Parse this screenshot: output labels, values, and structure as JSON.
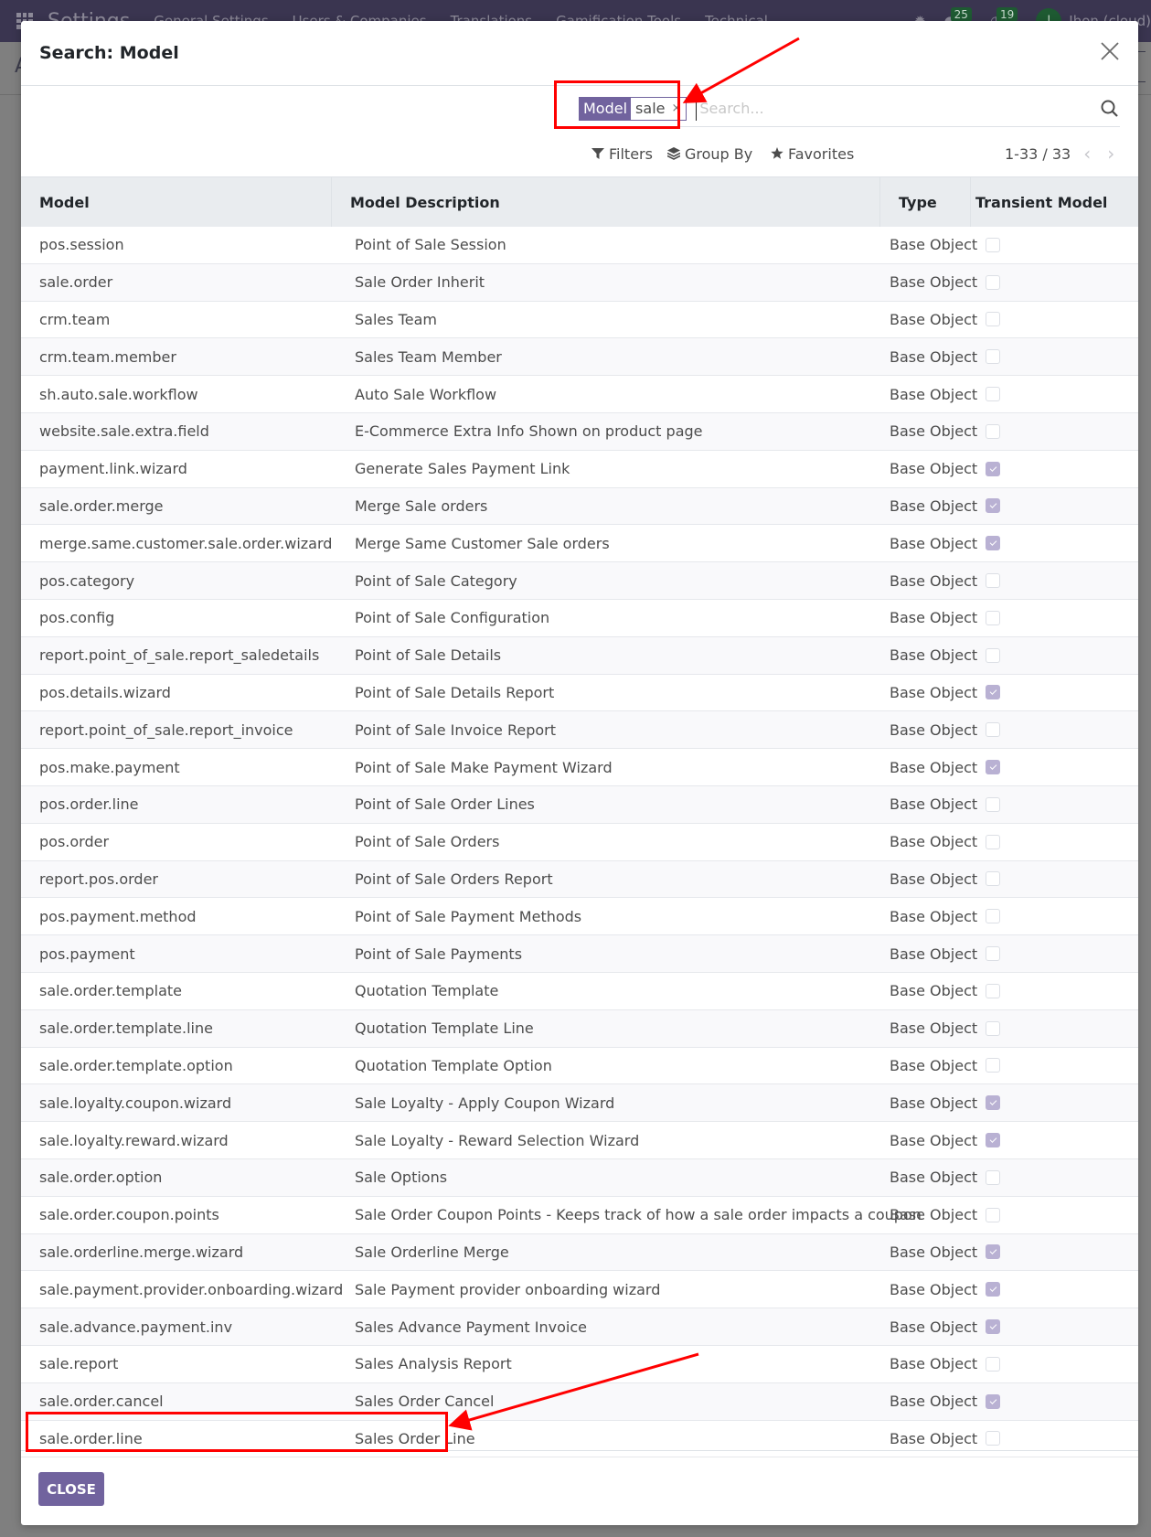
{
  "topbar": {
    "brand": "Settings",
    "menu": [
      "General Settings",
      "Users & Companies",
      "Translations",
      "Gamification Tools",
      "Technical"
    ],
    "messages_count": "25",
    "activities_count": "19",
    "avatar_initial": "I",
    "user_name": "Ihon (cloud)"
  },
  "background_page": {
    "title_initial": "A"
  },
  "modal": {
    "title": "Search: Model",
    "close_label": "×"
  },
  "search": {
    "facet_key": "Model",
    "facet_value": "sale",
    "facet_remove": "×",
    "placeholder": "Search..."
  },
  "controls": {
    "filters": "Filters",
    "group_by": "Group By",
    "favorites": "Favorites",
    "pager": "1-33 / 33"
  },
  "table": {
    "headers": [
      "Model",
      "Model Description",
      "Type",
      "Transient Model"
    ],
    "rows": [
      {
        "model": "pos.session",
        "description": "Point of Sale Session",
        "type": "Base Object",
        "transient": false
      },
      {
        "model": "sale.order",
        "description": "Sale Order Inherit",
        "type": "Base Object",
        "transient": false
      },
      {
        "model": "crm.team",
        "description": "Sales Team",
        "type": "Base Object",
        "transient": false
      },
      {
        "model": "crm.team.member",
        "description": "Sales Team Member",
        "type": "Base Object",
        "transient": false
      },
      {
        "model": "sh.auto.sale.workflow",
        "description": "Auto Sale Workflow",
        "type": "Base Object",
        "transient": false
      },
      {
        "model": "website.sale.extra.field",
        "description": "E-Commerce Extra Info Shown on product page",
        "type": "Base Object",
        "transient": false
      },
      {
        "model": "payment.link.wizard",
        "description": "Generate Sales Payment Link",
        "type": "Base Object",
        "transient": true
      },
      {
        "model": "sale.order.merge",
        "description": "Merge Sale orders",
        "type": "Base Object",
        "transient": true
      },
      {
        "model": "merge.same.customer.sale.order.wizard",
        "description": "Merge Same Customer Sale orders",
        "type": "Base Object",
        "transient": true
      },
      {
        "model": "pos.category",
        "description": "Point of Sale Category",
        "type": "Base Object",
        "transient": false
      },
      {
        "model": "pos.config",
        "description": "Point of Sale Configuration",
        "type": "Base Object",
        "transient": false
      },
      {
        "model": "report.point_of_sale.report_saledetails",
        "description": "Point of Sale Details",
        "type": "Base Object",
        "transient": false
      },
      {
        "model": "pos.details.wizard",
        "description": "Point of Sale Details Report",
        "type": "Base Object",
        "transient": true
      },
      {
        "model": "report.point_of_sale.report_invoice",
        "description": "Point of Sale Invoice Report",
        "type": "Base Object",
        "transient": false
      },
      {
        "model": "pos.make.payment",
        "description": "Point of Sale Make Payment Wizard",
        "type": "Base Object",
        "transient": true
      },
      {
        "model": "pos.order.line",
        "description": "Point of Sale Order Lines",
        "type": "Base Object",
        "transient": false
      },
      {
        "model": "pos.order",
        "description": "Point of Sale Orders",
        "type": "Base Object",
        "transient": false
      },
      {
        "model": "report.pos.order",
        "description": "Point of Sale Orders Report",
        "type": "Base Object",
        "transient": false
      },
      {
        "model": "pos.payment.method",
        "description": "Point of Sale Payment Methods",
        "type": "Base Object",
        "transient": false
      },
      {
        "model": "pos.payment",
        "description": "Point of Sale Payments",
        "type": "Base Object",
        "transient": false
      },
      {
        "model": "sale.order.template",
        "description": "Quotation Template",
        "type": "Base Object",
        "transient": false
      },
      {
        "model": "sale.order.template.line",
        "description": "Quotation Template Line",
        "type": "Base Object",
        "transient": false
      },
      {
        "model": "sale.order.template.option",
        "description": "Quotation Template Option",
        "type": "Base Object",
        "transient": false
      },
      {
        "model": "sale.loyalty.coupon.wizard",
        "description": "Sale Loyalty - Apply Coupon Wizard",
        "type": "Base Object",
        "transient": true
      },
      {
        "model": "sale.loyalty.reward.wizard",
        "description": "Sale Loyalty - Reward Selection Wizard",
        "type": "Base Object",
        "transient": true
      },
      {
        "model": "sale.order.option",
        "description": "Sale Options",
        "type": "Base Object",
        "transient": false
      },
      {
        "model": "sale.order.coupon.points",
        "description": "Sale Order Coupon Points - Keeps track of how a sale order impacts a coupon",
        "type": "Base Object",
        "transient": false
      },
      {
        "model": "sale.orderline.merge.wizard",
        "description": "Sale Orderline Merge",
        "type": "Base Object",
        "transient": true
      },
      {
        "model": "sale.payment.provider.onboarding.wizard",
        "description": "Sale Payment provider onboarding wizard",
        "type": "Base Object",
        "transient": true
      },
      {
        "model": "sale.advance.payment.inv",
        "description": "Sales Advance Payment Invoice",
        "type": "Base Object",
        "transient": true
      },
      {
        "model": "sale.report",
        "description": "Sales Analysis Report",
        "type": "Base Object",
        "transient": false
      },
      {
        "model": "sale.order.cancel",
        "description": "Sales Order Cancel",
        "type": "Base Object",
        "transient": true
      },
      {
        "model": "sale.order.line",
        "description": "Sales Order Line",
        "type": "Base Object",
        "transient": false
      }
    ]
  },
  "footer": {
    "close_button": "CLOSE"
  },
  "colors": {
    "brand": "#71639e",
    "navbar": "#3a3550",
    "checked": "#b9b1d3",
    "annotation": "#ff0000",
    "header_bg": "#e9ecef"
  }
}
